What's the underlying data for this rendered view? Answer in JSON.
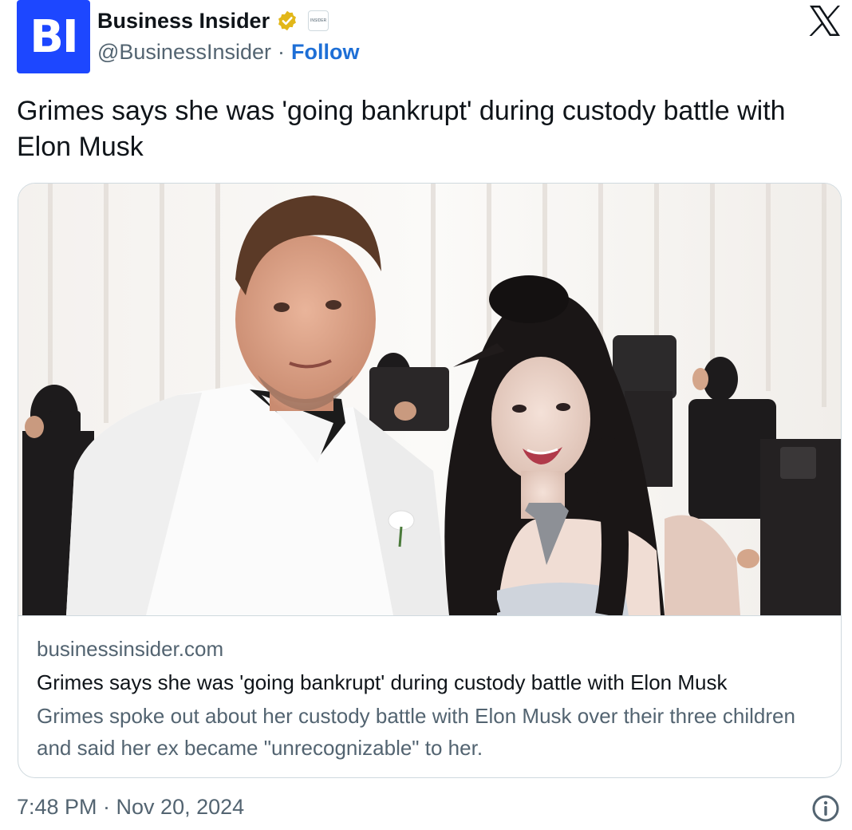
{
  "author": {
    "avatar_text": "BI",
    "name": "Business Insider",
    "handle": "@BusinessInsider",
    "separator": "·",
    "follow_label": "Follow",
    "affiliate_badge_text": "INSIDER",
    "verified_icon": "verified-gold-badge-icon"
  },
  "tweet": {
    "text": "Grimes says she was 'going bankrupt' during custody battle with Elon Musk"
  },
  "card": {
    "image_description_icon": "article-photo",
    "domain": "businessinsider.com",
    "title": "Grimes says she was 'going bankrupt' during custody battle with Elon Musk",
    "description": "Grimes spoke out about her custody battle with Elon Musk over their three children and said her ex became \"unrecognizable\" to her."
  },
  "footer": {
    "timestamp": "7:48 PM · Nov 20, 2024",
    "info_icon": "info-icon"
  },
  "colors": {
    "brand_blue": "#1d47ff",
    "follow_blue": "#1e6fd6",
    "secondary_text": "#536471",
    "border": "#cfd9de",
    "verified_gold": "#e2b719"
  }
}
